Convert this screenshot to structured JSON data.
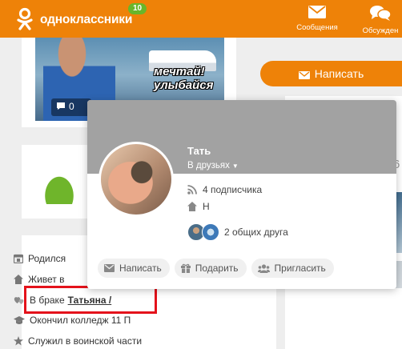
{
  "topbar": {
    "logo_text": "одноклассники",
    "badge": "10",
    "nav": {
      "messages_label": "Сообщения",
      "discussions_label": "Обсужден"
    }
  },
  "left_photo": {
    "caption_line1": "мечтай!",
    "caption_line2": "улыбайся",
    "comment_count": "0"
  },
  "write_button_label": "Написать",
  "right_column_digit": "6",
  "info": {
    "born_label": "Родился",
    "lives_label": "Живет в",
    "married_label": "В браке",
    "married_link": "Татьяна /",
    "education_label": "Окончил колледж 11 П",
    "army_label": "Служил в воинской части"
  },
  "popup": {
    "name": "Тать",
    "status": "В друзьях",
    "subscribers": "4 подписчика",
    "location": "Н",
    "mutual_friends": "2 общих друга",
    "actions": {
      "write": "Написать",
      "gift": "Подарить",
      "invite": "Пригласить"
    }
  },
  "colors": {
    "brand_orange": "#ee8208",
    "badge_green": "#68b62a",
    "highlight_red": "#e4121b"
  }
}
